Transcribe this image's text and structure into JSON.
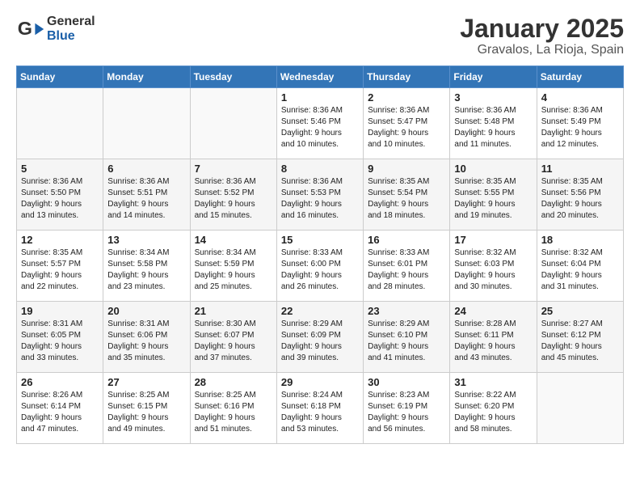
{
  "header": {
    "logo_general": "General",
    "logo_blue": "Blue",
    "title": "January 2025",
    "subtitle": "Gravalos, La Rioja, Spain"
  },
  "days_of_week": [
    "Sunday",
    "Monday",
    "Tuesday",
    "Wednesday",
    "Thursday",
    "Friday",
    "Saturday"
  ],
  "weeks": [
    [
      {
        "day": "",
        "info": ""
      },
      {
        "day": "",
        "info": ""
      },
      {
        "day": "",
        "info": ""
      },
      {
        "day": "1",
        "info": "Sunrise: 8:36 AM\nSunset: 5:46 PM\nDaylight: 9 hours\nand 10 minutes."
      },
      {
        "day": "2",
        "info": "Sunrise: 8:36 AM\nSunset: 5:47 PM\nDaylight: 9 hours\nand 10 minutes."
      },
      {
        "day": "3",
        "info": "Sunrise: 8:36 AM\nSunset: 5:48 PM\nDaylight: 9 hours\nand 11 minutes."
      },
      {
        "day": "4",
        "info": "Sunrise: 8:36 AM\nSunset: 5:49 PM\nDaylight: 9 hours\nand 12 minutes."
      }
    ],
    [
      {
        "day": "5",
        "info": "Sunrise: 8:36 AM\nSunset: 5:50 PM\nDaylight: 9 hours\nand 13 minutes."
      },
      {
        "day": "6",
        "info": "Sunrise: 8:36 AM\nSunset: 5:51 PM\nDaylight: 9 hours\nand 14 minutes."
      },
      {
        "day": "7",
        "info": "Sunrise: 8:36 AM\nSunset: 5:52 PM\nDaylight: 9 hours\nand 15 minutes."
      },
      {
        "day": "8",
        "info": "Sunrise: 8:36 AM\nSunset: 5:53 PM\nDaylight: 9 hours\nand 16 minutes."
      },
      {
        "day": "9",
        "info": "Sunrise: 8:35 AM\nSunset: 5:54 PM\nDaylight: 9 hours\nand 18 minutes."
      },
      {
        "day": "10",
        "info": "Sunrise: 8:35 AM\nSunset: 5:55 PM\nDaylight: 9 hours\nand 19 minutes."
      },
      {
        "day": "11",
        "info": "Sunrise: 8:35 AM\nSunset: 5:56 PM\nDaylight: 9 hours\nand 20 minutes."
      }
    ],
    [
      {
        "day": "12",
        "info": "Sunrise: 8:35 AM\nSunset: 5:57 PM\nDaylight: 9 hours\nand 22 minutes."
      },
      {
        "day": "13",
        "info": "Sunrise: 8:34 AM\nSunset: 5:58 PM\nDaylight: 9 hours\nand 23 minutes."
      },
      {
        "day": "14",
        "info": "Sunrise: 8:34 AM\nSunset: 5:59 PM\nDaylight: 9 hours\nand 25 minutes."
      },
      {
        "day": "15",
        "info": "Sunrise: 8:33 AM\nSunset: 6:00 PM\nDaylight: 9 hours\nand 26 minutes."
      },
      {
        "day": "16",
        "info": "Sunrise: 8:33 AM\nSunset: 6:01 PM\nDaylight: 9 hours\nand 28 minutes."
      },
      {
        "day": "17",
        "info": "Sunrise: 8:32 AM\nSunset: 6:03 PM\nDaylight: 9 hours\nand 30 minutes."
      },
      {
        "day": "18",
        "info": "Sunrise: 8:32 AM\nSunset: 6:04 PM\nDaylight: 9 hours\nand 31 minutes."
      }
    ],
    [
      {
        "day": "19",
        "info": "Sunrise: 8:31 AM\nSunset: 6:05 PM\nDaylight: 9 hours\nand 33 minutes."
      },
      {
        "day": "20",
        "info": "Sunrise: 8:31 AM\nSunset: 6:06 PM\nDaylight: 9 hours\nand 35 minutes."
      },
      {
        "day": "21",
        "info": "Sunrise: 8:30 AM\nSunset: 6:07 PM\nDaylight: 9 hours\nand 37 minutes."
      },
      {
        "day": "22",
        "info": "Sunrise: 8:29 AM\nSunset: 6:09 PM\nDaylight: 9 hours\nand 39 minutes."
      },
      {
        "day": "23",
        "info": "Sunrise: 8:29 AM\nSunset: 6:10 PM\nDaylight: 9 hours\nand 41 minutes."
      },
      {
        "day": "24",
        "info": "Sunrise: 8:28 AM\nSunset: 6:11 PM\nDaylight: 9 hours\nand 43 minutes."
      },
      {
        "day": "25",
        "info": "Sunrise: 8:27 AM\nSunset: 6:12 PM\nDaylight: 9 hours\nand 45 minutes."
      }
    ],
    [
      {
        "day": "26",
        "info": "Sunrise: 8:26 AM\nSunset: 6:14 PM\nDaylight: 9 hours\nand 47 minutes."
      },
      {
        "day": "27",
        "info": "Sunrise: 8:25 AM\nSunset: 6:15 PM\nDaylight: 9 hours\nand 49 minutes."
      },
      {
        "day": "28",
        "info": "Sunrise: 8:25 AM\nSunset: 6:16 PM\nDaylight: 9 hours\nand 51 minutes."
      },
      {
        "day": "29",
        "info": "Sunrise: 8:24 AM\nSunset: 6:18 PM\nDaylight: 9 hours\nand 53 minutes."
      },
      {
        "day": "30",
        "info": "Sunrise: 8:23 AM\nSunset: 6:19 PM\nDaylight: 9 hours\nand 56 minutes."
      },
      {
        "day": "31",
        "info": "Sunrise: 8:22 AM\nSunset: 6:20 PM\nDaylight: 9 hours\nand 58 minutes."
      },
      {
        "day": "",
        "info": ""
      }
    ]
  ]
}
